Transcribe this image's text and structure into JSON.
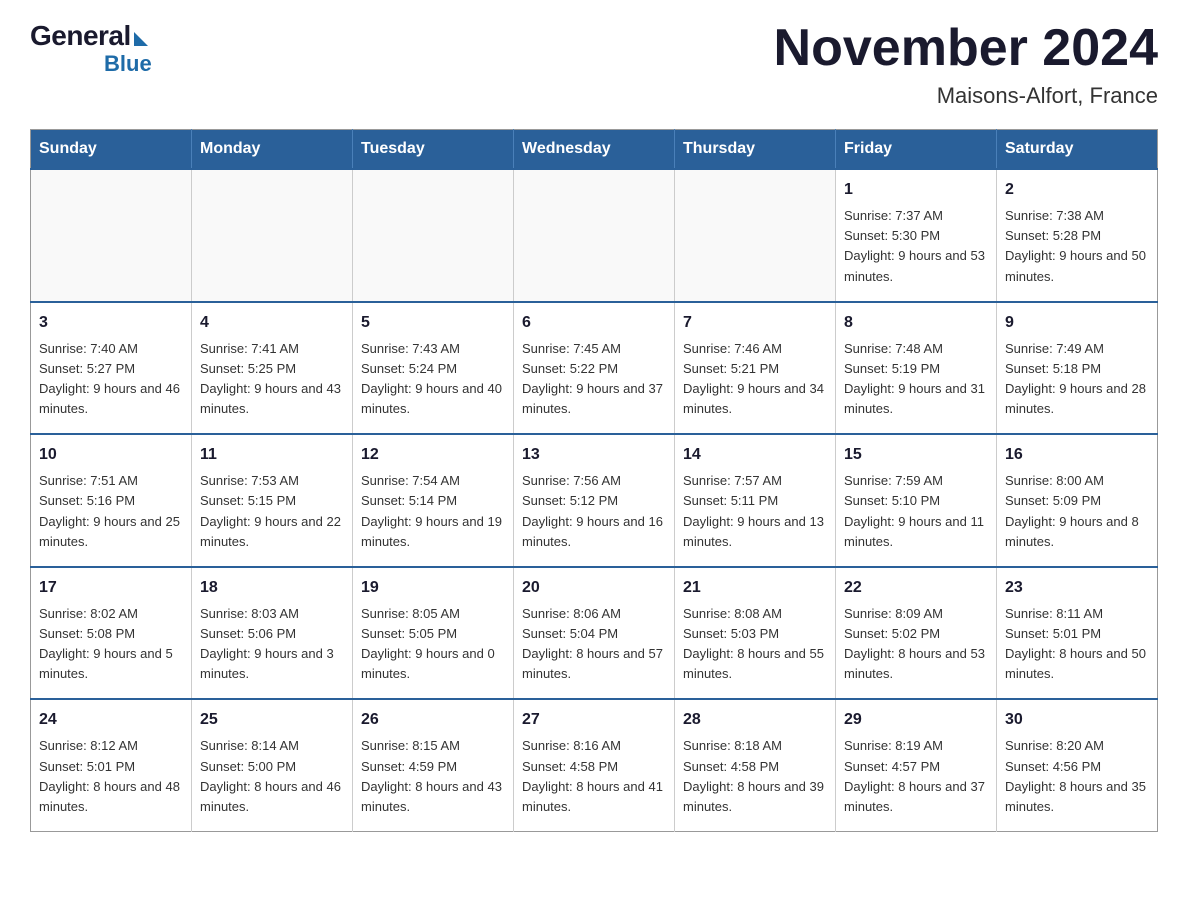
{
  "logo": {
    "general": "General",
    "blue": "Blue"
  },
  "header": {
    "month_year": "November 2024",
    "location": "Maisons-Alfort, France"
  },
  "weekdays": [
    "Sunday",
    "Monday",
    "Tuesday",
    "Wednesday",
    "Thursday",
    "Friday",
    "Saturday"
  ],
  "weeks": [
    {
      "days": [
        {
          "num": "",
          "info": ""
        },
        {
          "num": "",
          "info": ""
        },
        {
          "num": "",
          "info": ""
        },
        {
          "num": "",
          "info": ""
        },
        {
          "num": "",
          "info": ""
        },
        {
          "num": "1",
          "info": "Sunrise: 7:37 AM\nSunset: 5:30 PM\nDaylight: 9 hours and 53 minutes."
        },
        {
          "num": "2",
          "info": "Sunrise: 7:38 AM\nSunset: 5:28 PM\nDaylight: 9 hours and 50 minutes."
        }
      ]
    },
    {
      "days": [
        {
          "num": "3",
          "info": "Sunrise: 7:40 AM\nSunset: 5:27 PM\nDaylight: 9 hours and 46 minutes."
        },
        {
          "num": "4",
          "info": "Sunrise: 7:41 AM\nSunset: 5:25 PM\nDaylight: 9 hours and 43 minutes."
        },
        {
          "num": "5",
          "info": "Sunrise: 7:43 AM\nSunset: 5:24 PM\nDaylight: 9 hours and 40 minutes."
        },
        {
          "num": "6",
          "info": "Sunrise: 7:45 AM\nSunset: 5:22 PM\nDaylight: 9 hours and 37 minutes."
        },
        {
          "num": "7",
          "info": "Sunrise: 7:46 AM\nSunset: 5:21 PM\nDaylight: 9 hours and 34 minutes."
        },
        {
          "num": "8",
          "info": "Sunrise: 7:48 AM\nSunset: 5:19 PM\nDaylight: 9 hours and 31 minutes."
        },
        {
          "num": "9",
          "info": "Sunrise: 7:49 AM\nSunset: 5:18 PM\nDaylight: 9 hours and 28 minutes."
        }
      ]
    },
    {
      "days": [
        {
          "num": "10",
          "info": "Sunrise: 7:51 AM\nSunset: 5:16 PM\nDaylight: 9 hours and 25 minutes."
        },
        {
          "num": "11",
          "info": "Sunrise: 7:53 AM\nSunset: 5:15 PM\nDaylight: 9 hours and 22 minutes."
        },
        {
          "num": "12",
          "info": "Sunrise: 7:54 AM\nSunset: 5:14 PM\nDaylight: 9 hours and 19 minutes."
        },
        {
          "num": "13",
          "info": "Sunrise: 7:56 AM\nSunset: 5:12 PM\nDaylight: 9 hours and 16 minutes."
        },
        {
          "num": "14",
          "info": "Sunrise: 7:57 AM\nSunset: 5:11 PM\nDaylight: 9 hours and 13 minutes."
        },
        {
          "num": "15",
          "info": "Sunrise: 7:59 AM\nSunset: 5:10 PM\nDaylight: 9 hours and 11 minutes."
        },
        {
          "num": "16",
          "info": "Sunrise: 8:00 AM\nSunset: 5:09 PM\nDaylight: 9 hours and 8 minutes."
        }
      ]
    },
    {
      "days": [
        {
          "num": "17",
          "info": "Sunrise: 8:02 AM\nSunset: 5:08 PM\nDaylight: 9 hours and 5 minutes."
        },
        {
          "num": "18",
          "info": "Sunrise: 8:03 AM\nSunset: 5:06 PM\nDaylight: 9 hours and 3 minutes."
        },
        {
          "num": "19",
          "info": "Sunrise: 8:05 AM\nSunset: 5:05 PM\nDaylight: 9 hours and 0 minutes."
        },
        {
          "num": "20",
          "info": "Sunrise: 8:06 AM\nSunset: 5:04 PM\nDaylight: 8 hours and 57 minutes."
        },
        {
          "num": "21",
          "info": "Sunrise: 8:08 AM\nSunset: 5:03 PM\nDaylight: 8 hours and 55 minutes."
        },
        {
          "num": "22",
          "info": "Sunrise: 8:09 AM\nSunset: 5:02 PM\nDaylight: 8 hours and 53 minutes."
        },
        {
          "num": "23",
          "info": "Sunrise: 8:11 AM\nSunset: 5:01 PM\nDaylight: 8 hours and 50 minutes."
        }
      ]
    },
    {
      "days": [
        {
          "num": "24",
          "info": "Sunrise: 8:12 AM\nSunset: 5:01 PM\nDaylight: 8 hours and 48 minutes."
        },
        {
          "num": "25",
          "info": "Sunrise: 8:14 AM\nSunset: 5:00 PM\nDaylight: 8 hours and 46 minutes."
        },
        {
          "num": "26",
          "info": "Sunrise: 8:15 AM\nSunset: 4:59 PM\nDaylight: 8 hours and 43 minutes."
        },
        {
          "num": "27",
          "info": "Sunrise: 8:16 AM\nSunset: 4:58 PM\nDaylight: 8 hours and 41 minutes."
        },
        {
          "num": "28",
          "info": "Sunrise: 8:18 AM\nSunset: 4:58 PM\nDaylight: 8 hours and 39 minutes."
        },
        {
          "num": "29",
          "info": "Sunrise: 8:19 AM\nSunset: 4:57 PM\nDaylight: 8 hours and 37 minutes."
        },
        {
          "num": "30",
          "info": "Sunrise: 8:20 AM\nSunset: 4:56 PM\nDaylight: 8 hours and 35 minutes."
        }
      ]
    }
  ]
}
